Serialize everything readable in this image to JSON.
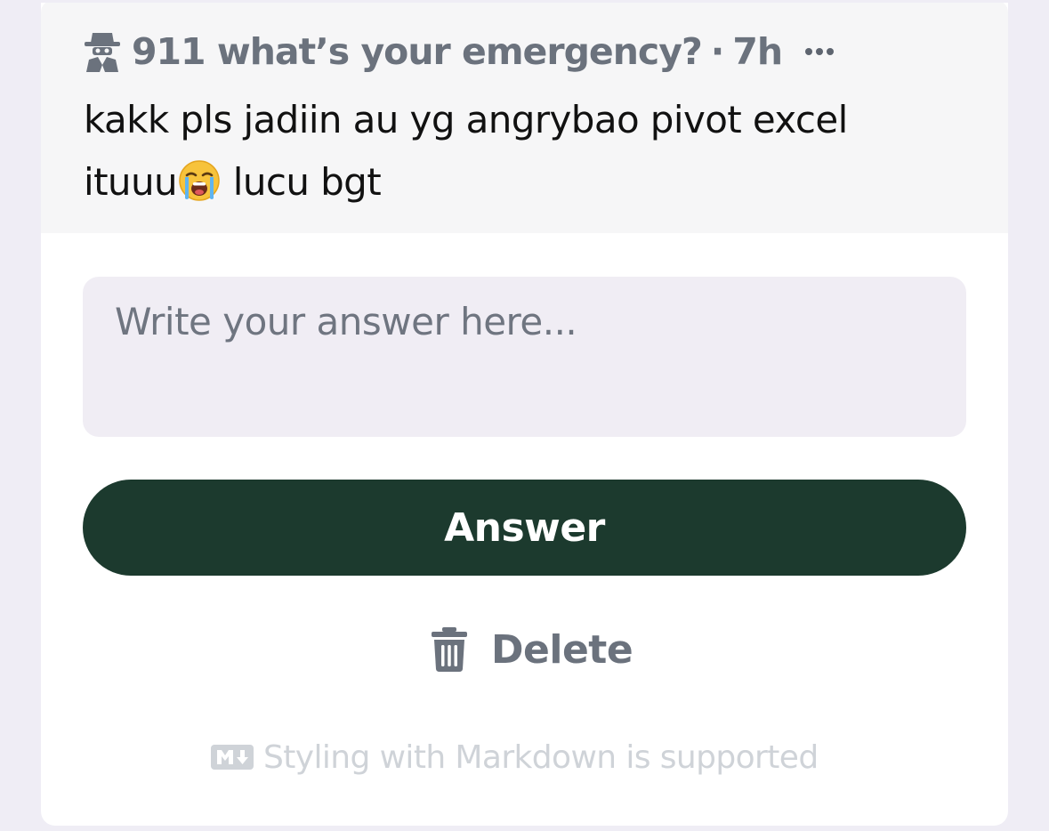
{
  "post": {
    "author": "911 what’s your emergency?",
    "separator": "·",
    "time_ago": "7h",
    "author_icon": "spy-icon",
    "menu_icon": "more-dots-icon",
    "question_line1": "kakk pls jadiin au yg angrybao pivot excel",
    "question_line2_before": "ituuu",
    "question_emoji": "loudly-crying-face-emoji",
    "question_line2_after": " lucu bgt"
  },
  "answer_form": {
    "placeholder": "Write your answer here...",
    "value": "",
    "submit_label": "Answer",
    "delete_label": "Delete",
    "delete_icon": "trash-icon",
    "markdown_note": "Styling with Markdown is supported",
    "markdown_icon": "markdown-icon"
  },
  "colors": {
    "page_background": "#efedf5",
    "card_header_background": "#f6f6f7",
    "input_background": "#f0edf4",
    "answer_button": "#1c3a2e",
    "muted_text": "#6b727d",
    "hint_text": "#cfd3d8"
  }
}
